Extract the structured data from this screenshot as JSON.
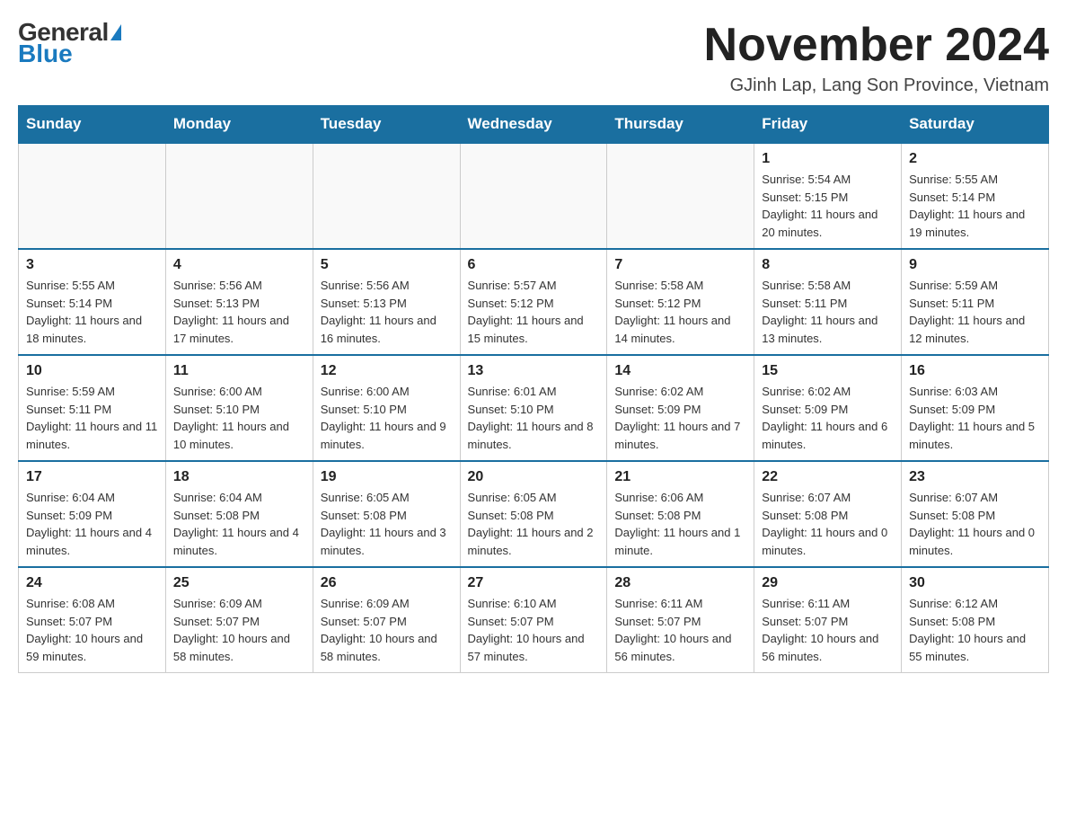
{
  "logo": {
    "general": "General",
    "blue": "Blue"
  },
  "header": {
    "month_year": "November 2024",
    "location": "GJinh Lap, Lang Son Province, Vietnam"
  },
  "weekdays": [
    "Sunday",
    "Monday",
    "Tuesday",
    "Wednesday",
    "Thursday",
    "Friday",
    "Saturday"
  ],
  "weeks": [
    [
      {
        "day": "",
        "info": ""
      },
      {
        "day": "",
        "info": ""
      },
      {
        "day": "",
        "info": ""
      },
      {
        "day": "",
        "info": ""
      },
      {
        "day": "",
        "info": ""
      },
      {
        "day": "1",
        "info": "Sunrise: 5:54 AM\nSunset: 5:15 PM\nDaylight: 11 hours and 20 minutes."
      },
      {
        "day": "2",
        "info": "Sunrise: 5:55 AM\nSunset: 5:14 PM\nDaylight: 11 hours and 19 minutes."
      }
    ],
    [
      {
        "day": "3",
        "info": "Sunrise: 5:55 AM\nSunset: 5:14 PM\nDaylight: 11 hours and 18 minutes."
      },
      {
        "day": "4",
        "info": "Sunrise: 5:56 AM\nSunset: 5:13 PM\nDaylight: 11 hours and 17 minutes."
      },
      {
        "day": "5",
        "info": "Sunrise: 5:56 AM\nSunset: 5:13 PM\nDaylight: 11 hours and 16 minutes."
      },
      {
        "day": "6",
        "info": "Sunrise: 5:57 AM\nSunset: 5:12 PM\nDaylight: 11 hours and 15 minutes."
      },
      {
        "day": "7",
        "info": "Sunrise: 5:58 AM\nSunset: 5:12 PM\nDaylight: 11 hours and 14 minutes."
      },
      {
        "day": "8",
        "info": "Sunrise: 5:58 AM\nSunset: 5:11 PM\nDaylight: 11 hours and 13 minutes."
      },
      {
        "day": "9",
        "info": "Sunrise: 5:59 AM\nSunset: 5:11 PM\nDaylight: 11 hours and 12 minutes."
      }
    ],
    [
      {
        "day": "10",
        "info": "Sunrise: 5:59 AM\nSunset: 5:11 PM\nDaylight: 11 hours and 11 minutes."
      },
      {
        "day": "11",
        "info": "Sunrise: 6:00 AM\nSunset: 5:10 PM\nDaylight: 11 hours and 10 minutes."
      },
      {
        "day": "12",
        "info": "Sunrise: 6:00 AM\nSunset: 5:10 PM\nDaylight: 11 hours and 9 minutes."
      },
      {
        "day": "13",
        "info": "Sunrise: 6:01 AM\nSunset: 5:10 PM\nDaylight: 11 hours and 8 minutes."
      },
      {
        "day": "14",
        "info": "Sunrise: 6:02 AM\nSunset: 5:09 PM\nDaylight: 11 hours and 7 minutes."
      },
      {
        "day": "15",
        "info": "Sunrise: 6:02 AM\nSunset: 5:09 PM\nDaylight: 11 hours and 6 minutes."
      },
      {
        "day": "16",
        "info": "Sunrise: 6:03 AM\nSunset: 5:09 PM\nDaylight: 11 hours and 5 minutes."
      }
    ],
    [
      {
        "day": "17",
        "info": "Sunrise: 6:04 AM\nSunset: 5:09 PM\nDaylight: 11 hours and 4 minutes."
      },
      {
        "day": "18",
        "info": "Sunrise: 6:04 AM\nSunset: 5:08 PM\nDaylight: 11 hours and 4 minutes."
      },
      {
        "day": "19",
        "info": "Sunrise: 6:05 AM\nSunset: 5:08 PM\nDaylight: 11 hours and 3 minutes."
      },
      {
        "day": "20",
        "info": "Sunrise: 6:05 AM\nSunset: 5:08 PM\nDaylight: 11 hours and 2 minutes."
      },
      {
        "day": "21",
        "info": "Sunrise: 6:06 AM\nSunset: 5:08 PM\nDaylight: 11 hours and 1 minute."
      },
      {
        "day": "22",
        "info": "Sunrise: 6:07 AM\nSunset: 5:08 PM\nDaylight: 11 hours and 0 minutes."
      },
      {
        "day": "23",
        "info": "Sunrise: 6:07 AM\nSunset: 5:08 PM\nDaylight: 11 hours and 0 minutes."
      }
    ],
    [
      {
        "day": "24",
        "info": "Sunrise: 6:08 AM\nSunset: 5:07 PM\nDaylight: 10 hours and 59 minutes."
      },
      {
        "day": "25",
        "info": "Sunrise: 6:09 AM\nSunset: 5:07 PM\nDaylight: 10 hours and 58 minutes."
      },
      {
        "day": "26",
        "info": "Sunrise: 6:09 AM\nSunset: 5:07 PM\nDaylight: 10 hours and 58 minutes."
      },
      {
        "day": "27",
        "info": "Sunrise: 6:10 AM\nSunset: 5:07 PM\nDaylight: 10 hours and 57 minutes."
      },
      {
        "day": "28",
        "info": "Sunrise: 6:11 AM\nSunset: 5:07 PM\nDaylight: 10 hours and 56 minutes."
      },
      {
        "day": "29",
        "info": "Sunrise: 6:11 AM\nSunset: 5:07 PM\nDaylight: 10 hours and 56 minutes."
      },
      {
        "day": "30",
        "info": "Sunrise: 6:12 AM\nSunset: 5:08 PM\nDaylight: 10 hours and 55 minutes."
      }
    ]
  ]
}
